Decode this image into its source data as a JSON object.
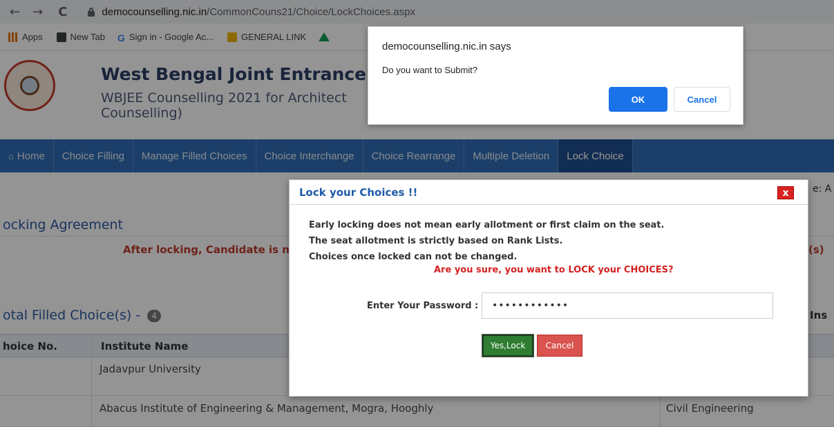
{
  "browser": {
    "url_host": "democounselling.nic.in",
    "url_path": "/CommonCouns21/Choice/LockChoices.aspx",
    "back": "←",
    "forward": "→",
    "reload": "C",
    "bookmarks": [
      "Apps",
      "New Tab",
      "Sign in - Google Ac...",
      "GENERAL LINK"
    ]
  },
  "header": {
    "title": "West Bengal Joint Entrance E",
    "subtitle": "WBJEE Counselling 2021 for Architect Counselling)"
  },
  "nav": {
    "items": [
      "Home",
      "Choice Filling",
      "Manage Filled Choices",
      "Choice Interchange",
      "Choice Rearrange",
      "Multiple Deletion",
      "Lock Choice"
    ],
    "home_icon": "home-icon"
  },
  "content": {
    "date_fragment": "e: A",
    "agreement_title": "ocking Agreement",
    "agreement_text": "After locking, Candidate is n",
    "agreement_right": "(s)",
    "total_title": "otal Filled Choice(s) - ",
    "total_count": "4",
    "total_right": "Ins",
    "columns": [
      "hoice No.",
      "Institute Name"
    ],
    "rows": [
      {
        "institute": "Jadavpur University",
        "branch": ""
      },
      {
        "institute": "Abacus Institute of Engineering & Management, Mogra, Hooghly",
        "branch": "Civil Engineering"
      }
    ]
  },
  "modal": {
    "title": "Lock your Choices !!",
    "close": "x",
    "lines": [
      "Early locking does not mean early allotment or first claim on the seat.",
      "The seat allotment is strictly based on Rank Lists.",
      "Choices once locked can not be changed."
    ],
    "warning": "Are you sure, you want to LOCK your CHOICES?",
    "password_label": "Enter Your Password :",
    "password_value": "••••••••••••",
    "yes_label": "Yes,Lock",
    "cancel_label": "Cancel"
  },
  "alert": {
    "title": "democounselling.nic.in says",
    "message": "Do you want to Submit?",
    "ok_label": "OK",
    "cancel_label": "Cancel"
  },
  "colors": {
    "nav": "#2f6db5",
    "nav_active": "#1f4f8f",
    "accent_red": "#d42020",
    "alert_ok": "#1a73e8"
  }
}
